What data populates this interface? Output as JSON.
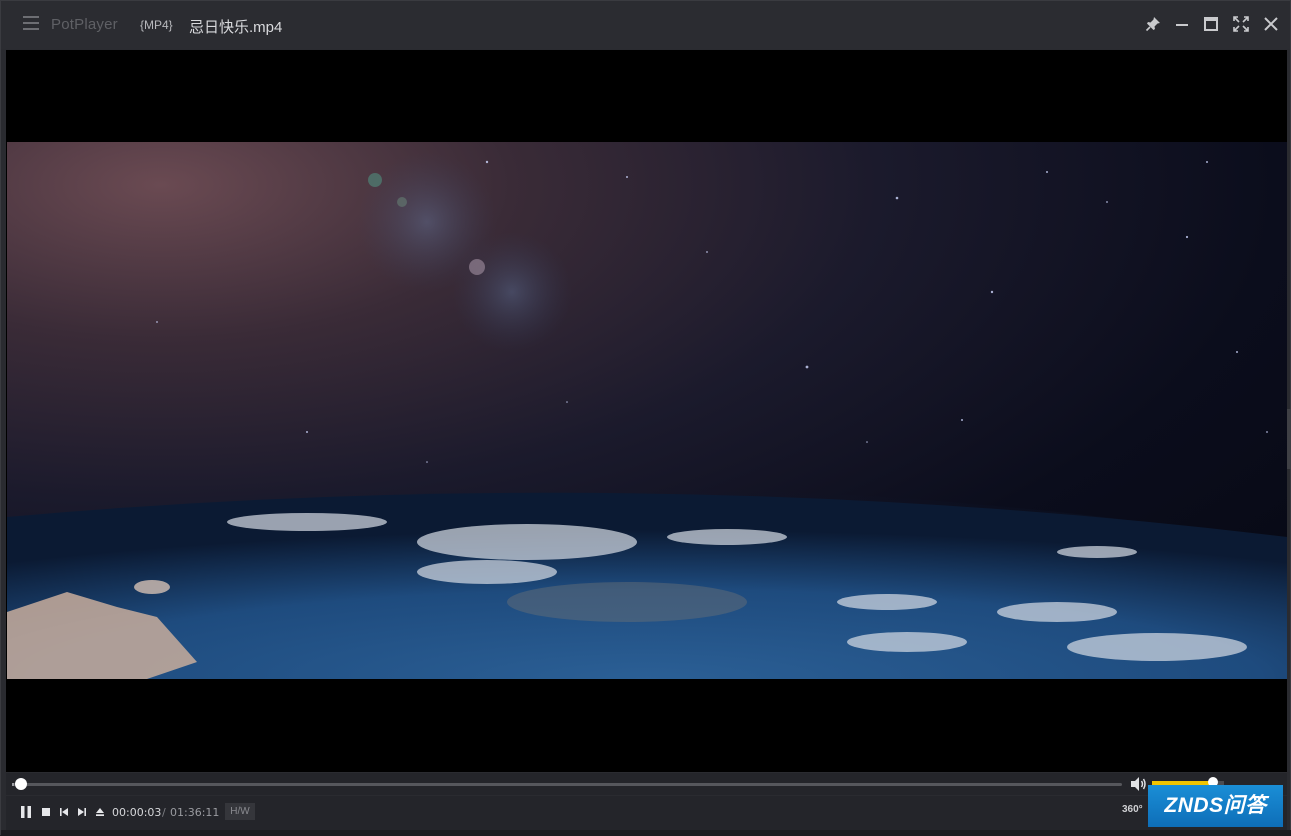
{
  "title_bar": {
    "app_name": "PotPlayer",
    "format_tag": "{MP4}",
    "file_name": "忌日快乐.mp4",
    "menu_icon": "hamburger-menu-icon",
    "window_buttons": [
      "pin-icon",
      "minimize-icon",
      "maximize-icon",
      "fullscreen-icon",
      "close-icon"
    ]
  },
  "playback": {
    "current_time": "00:00:03",
    "separator": "/",
    "total_time": "01:36:11",
    "progress_fraction": 0.0007,
    "state": "playing",
    "hw_label": "H/W",
    "vr_label": "360°",
    "volume_fraction": 0.85
  },
  "controls": {
    "icons": [
      "pause-icon",
      "stop-icon",
      "previous-icon",
      "next-icon",
      "eject-icon",
      "volume-icon"
    ]
  },
  "watermark": {
    "text": "ZNDS问答"
  },
  "colors": {
    "accent_volume": "#f2c400",
    "title_bar_bg": "#2b2c31",
    "controls_bg": "#24252a",
    "watermark_bg": "#0e6eb8"
  }
}
